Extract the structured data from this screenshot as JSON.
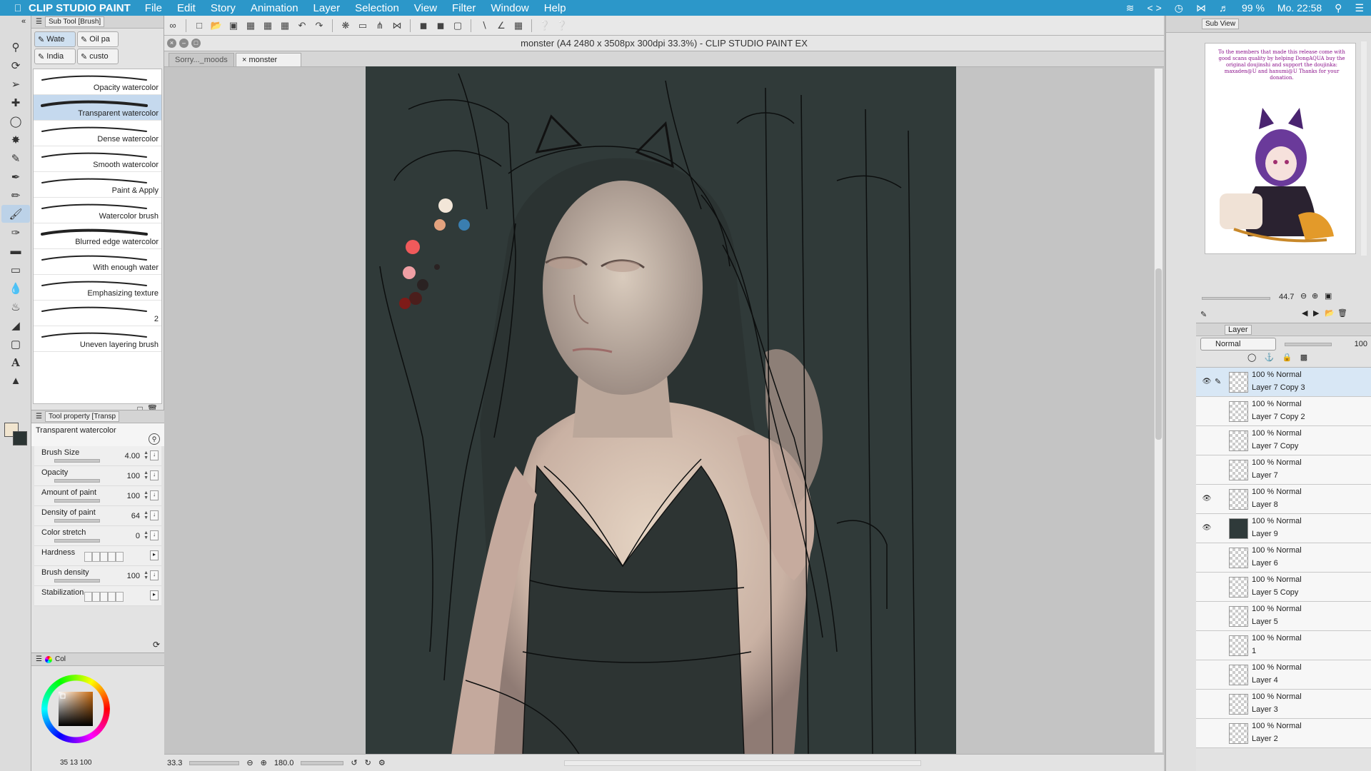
{
  "menubar": {
    "app": "CLIP STUDIO PAINT",
    "items": [
      "File",
      "Edit",
      "Story",
      "Animation",
      "Layer",
      "Selection",
      "View",
      "Filter",
      "Window",
      "Help"
    ],
    "battery": "99 %",
    "clock": "Mo. 22:58"
  },
  "subtool": {
    "header": "Sub Tool [Brush]",
    "tabs": [
      "Wate",
      "Oil pa",
      "India",
      "custo"
    ],
    "brushes": [
      "Opacity watercolor",
      "Transparent watercolor",
      "Dense watercolor",
      "Smooth watercolor",
      "Paint & Apply",
      "Watercolor brush",
      "Blurred edge watercolor",
      "With enough water",
      "Emphasizing texture",
      "2",
      "Uneven layering brush"
    ],
    "active_index": 1
  },
  "toolprop": {
    "header": "Tool property [Transp",
    "name": "Transparent watercolor",
    "rows": [
      {
        "label": "Brush Size",
        "value": "4.00"
      },
      {
        "label": "Opacity",
        "value": "100"
      },
      {
        "label": "Amount of paint",
        "value": "100"
      },
      {
        "label": "Density of paint",
        "value": "64"
      },
      {
        "label": "Color stretch",
        "value": "0"
      },
      {
        "label": "Hardness",
        "value": ""
      },
      {
        "label": "Brush density",
        "value": "100"
      },
      {
        "label": "Stabilization",
        "value": ""
      }
    ]
  },
  "colorpanel": {
    "tab": "Col",
    "values": "35  13  100"
  },
  "canvas": {
    "title": "monster (A4 2480 x 3508px 300dpi 33.3%)  - CLIP STUDIO PAINT EX",
    "tabs": [
      "Sorry..._moods",
      "monster"
    ],
    "active_tab": 1,
    "zoom": "33.3",
    "angle": "180.0"
  },
  "subview": {
    "tab": "Sub View",
    "note": "To the members that made this release come with good scans quality by helping DongAQUA buy the original doujinshi and support the doujinka: maxaden@U and hanumi@U Thanks for your donation.",
    "zoom": "44.7"
  },
  "layers": {
    "tab": "Layer",
    "blend": "Normal",
    "opacity": "100",
    "items": [
      {
        "mode": "100 % Normal",
        "name": "Layer 7 Copy 3",
        "visible": true,
        "selected": true
      },
      {
        "mode": "100 % Normal",
        "name": "Layer 7 Copy 2",
        "visible": false
      },
      {
        "mode": "100 % Normal",
        "name": "Layer 7 Copy",
        "visible": false
      },
      {
        "mode": "100 % Normal",
        "name": "Layer 7",
        "visible": false
      },
      {
        "mode": "100 % Normal",
        "name": "Layer 8",
        "visible": true
      },
      {
        "mode": "100 % Normal",
        "name": "Layer 9",
        "visible": true,
        "dark": true
      },
      {
        "mode": "100 % Normal",
        "name": "Layer 6",
        "visible": false
      },
      {
        "mode": "100 % Normal",
        "name": "Layer 5 Copy",
        "visible": false
      },
      {
        "mode": "100 % Normal",
        "name": "Layer 5",
        "visible": false
      },
      {
        "mode": "100 % Normal",
        "name": "1",
        "visible": false
      },
      {
        "mode": "100 % Normal",
        "name": "Layer 4",
        "visible": false
      },
      {
        "mode": "100 % Normal",
        "name": "Layer 3",
        "visible": false
      },
      {
        "mode": "100 % Normal",
        "name": "Layer 2",
        "visible": false
      }
    ]
  },
  "colors": {
    "menubar": "#2c97c9",
    "canvas_bg": "#303a39",
    "selection": "#c5d9ee"
  }
}
